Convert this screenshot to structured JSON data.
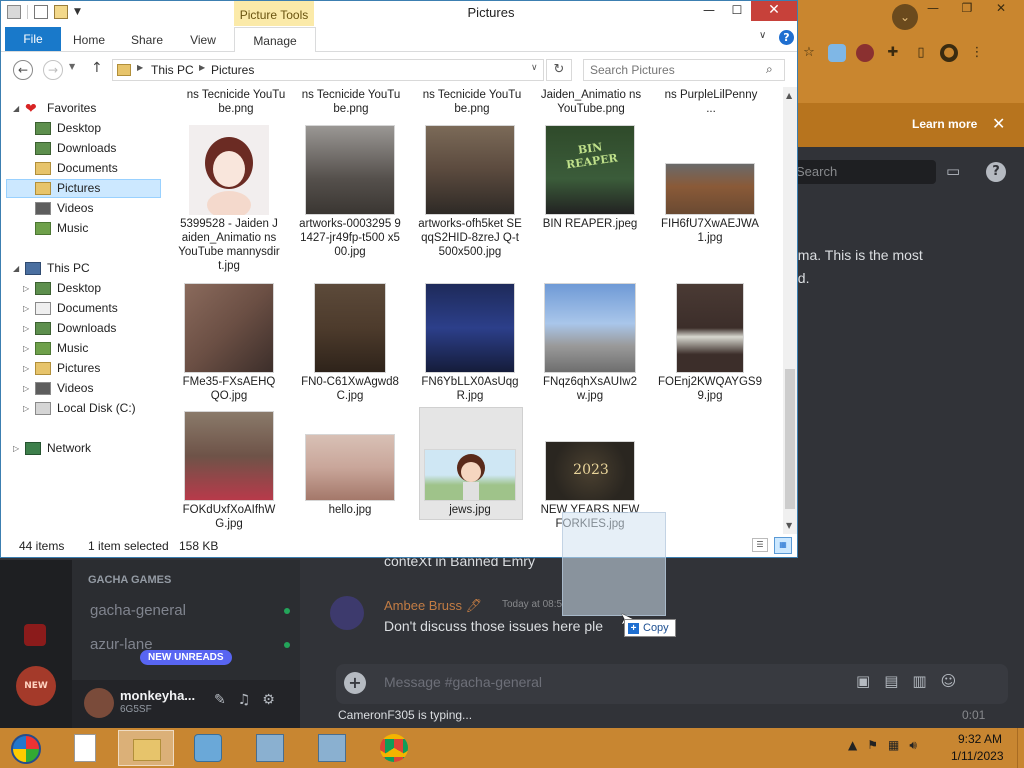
{
  "background": {
    "chrome_banner": {
      "learn_more": "Learn more",
      "close": "✕"
    },
    "discord": {
      "search_placeholder": "Search",
      "right_text_1": "ama. This is the most",
      "right_text_2": "ed.",
      "category": "GACHA GAMES",
      "channels": [
        {
          "label": "gacha-general"
        },
        {
          "label": "azur-lane"
        }
      ],
      "new_unreads": "NEW UNREADS",
      "user": {
        "name": "monkeyha...",
        "tag": "6G5SF"
      },
      "previous_message": "conteXt in Banned Emry",
      "message": {
        "author": "Ambee Bruss 🖊",
        "time": "Today at 08:5",
        "text": "Don't discuss those issues here ple"
      },
      "input_placeholder": "Message #gacha-general",
      "typing": "CameronF305 is typing...",
      "typing_time": "0:01",
      "server_badge": "NEW"
    }
  },
  "explorer": {
    "title": "Pictures",
    "contextual_tab": "Picture Tools",
    "tabs": {
      "file": "File",
      "home": "Home",
      "share": "Share",
      "view": "View",
      "manage": "Manage"
    },
    "window_buttons": {
      "minimize": "—",
      "maximize": "☐",
      "close": "✕"
    },
    "address": {
      "segments": [
        "This PC",
        "Pictures"
      ]
    },
    "search_placeholder": "Search Pictures",
    "nav": {
      "favorites": "Favorites",
      "fav_items": [
        "Desktop",
        "Downloads",
        "Documents",
        "Pictures",
        "Videos",
        "Music"
      ],
      "this_pc": "This PC",
      "pc_items": [
        "Desktop",
        "Documents",
        "Downloads",
        "Music",
        "Pictures",
        "Videos",
        "Local Disk (C:)"
      ],
      "network": "Network"
    },
    "partial_row": [
      {
        "name": "ns Tecnicide YouTube.png"
      },
      {
        "name": "ns Tecnicide YouTube.png"
      },
      {
        "name": "ns Tecnicide YouTube.png"
      },
      {
        "name": "Jaiden_Animatio ns YouTube.png"
      },
      {
        "name": "ns PurpleLilPenny ..."
      }
    ],
    "files": [
      {
        "name": "5399528 - Jaiden Jaiden_Animatio ns YouTube mannysdirt.jpg",
        "color": "#f2eeee"
      },
      {
        "name": "artworks-0003295 91427-jr49fp-t500 x500.jpg",
        "color": "#6e6a66"
      },
      {
        "name": "artworks-ofh5ket SEqqS2HID-8zreJ Q-t500x500.jpg",
        "color": "#5b4a3e"
      },
      {
        "name": "BIN REAPER.jpeg",
        "color": "#3b5c3a"
      },
      {
        "name": "FIH6fU7XwAEJWA 1.jpg",
        "color": "#6a4a32"
      },
      {
        "name": "FMe35-FXsAEHQ QO.jpg",
        "color": "#6b4f44"
      },
      {
        "name": "FN0-C61XwAgwd8 C.jpg",
        "color": "#4d3b2c"
      },
      {
        "name": "FN6YbLLX0AsUqg R.jpg",
        "color": "#2c3f8a"
      },
      {
        "name": "FNqz6qhXsAUIw2 w.jpg",
        "color": "#8fb0d9"
      },
      {
        "name": "FOEnj2KWQAYGS9 9.jpg",
        "color": "#3c2e2a"
      },
      {
        "name": "FOKdUxfXoAIfhW G.jpg",
        "color": "#6e5348"
      },
      {
        "name": "hello.jpg",
        "color": "#c9a69a"
      },
      {
        "name": "jews.jpg",
        "color": "#9fc38a"
      },
      {
        "name": "NEW YEARS NEW FORKIES.jpg",
        "color": "#2a2620"
      }
    ],
    "thumb_text": {
      "bin_reaper": "BIN REAPER",
      "new_year": "2023"
    },
    "status": {
      "items": "44 items",
      "selected": "1 item selected",
      "size": "158 KB"
    },
    "drag": {
      "copy_label": "Copy"
    }
  },
  "taskbar": {
    "time": "9:32 AM",
    "date": "1/11/2023"
  }
}
